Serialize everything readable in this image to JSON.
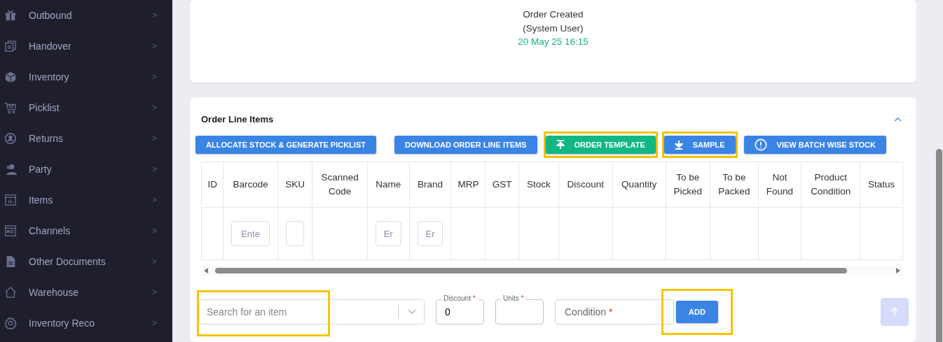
{
  "sidebar": {
    "items": [
      {
        "label": "Outbound",
        "chevron": ">"
      },
      {
        "label": "Handover",
        "chevron": ">"
      },
      {
        "label": "Inventory",
        "chevron": ">"
      },
      {
        "label": "Picklist",
        "chevron": ">"
      },
      {
        "label": "Returns",
        "chevron": ">"
      },
      {
        "label": "Party",
        "chevron": ">"
      },
      {
        "label": "Items",
        "chevron": ">"
      },
      {
        "label": "Channels",
        "chevron": ">"
      },
      {
        "label": "Other Documents",
        "chevron": ">"
      },
      {
        "label": "Warehouse",
        "chevron": ">"
      },
      {
        "label": "Inventory Reco",
        "chevron": ">"
      }
    ]
  },
  "timeline": {
    "event": "Order Created",
    "actor": "(System User)",
    "time": "20 May 25 16:15"
  },
  "line_items": {
    "title": "Order Line Items",
    "expanded": true,
    "buttons": [
      {
        "label": "ALLOCATE STOCK & GENERATE PICKLIST",
        "kind": "primary",
        "highlighted": false
      },
      {
        "label": "DOWNLOAD ORDER LINE ITEMS",
        "kind": "primary",
        "highlighted": false
      },
      {
        "label": "ORDER TEMPLATE",
        "kind": "success",
        "highlighted": true
      },
      {
        "label": "SAMPLE",
        "kind": "primary",
        "highlighted": true
      },
      {
        "label": "VIEW BATCH WISE STOCK",
        "kind": "primary",
        "highlighted": false
      }
    ],
    "table": {
      "columns": [
        {
          "label": "ID"
        },
        {
          "label": "Barcode"
        },
        {
          "label": "SKU"
        },
        {
          "label": "Scanned Code"
        },
        {
          "label": "Name"
        },
        {
          "label": "Brand"
        },
        {
          "label": "MRP"
        },
        {
          "label": "GST"
        },
        {
          "label": "Stock"
        },
        {
          "label": "Discount"
        },
        {
          "label": "Quantity"
        },
        {
          "label": "To be Picked"
        },
        {
          "label": "To be Packed"
        },
        {
          "label": "Not Found"
        },
        {
          "label": "Product Condition"
        },
        {
          "label": "Status"
        }
      ],
      "rows": [
        {
          "cells": [
            {
              "kind": "empty"
            },
            {
              "kind": "input",
              "placeholder": "Ente"
            },
            {
              "kind": "input"
            },
            {
              "kind": "empty"
            },
            {
              "kind": "input",
              "placeholder": "Er"
            },
            {
              "kind": "input",
              "placeholder": "Er"
            },
            {
              "kind": "empty"
            },
            {
              "kind": "empty"
            },
            {
              "kind": "empty"
            },
            {
              "kind": "empty"
            },
            {
              "kind": "empty"
            },
            {
              "kind": "empty"
            },
            {
              "kind": "empty"
            },
            {
              "kind": "empty"
            },
            {
              "kind": "empty"
            },
            {
              "kind": "empty"
            }
          ]
        }
      ]
    },
    "add_form": {
      "search": {
        "placeholder": "Search for an item",
        "highlighted": true
      },
      "discount": {
        "label": "Discount",
        "required_mark": "*",
        "value": "0"
      },
      "units": {
        "label": "Units",
        "required_mark": "*"
      },
      "condition": {
        "placeholder": "Condition",
        "required_mark": "*"
      },
      "add_button": {
        "label": "ADD",
        "highlighted": true
      }
    }
  }
}
